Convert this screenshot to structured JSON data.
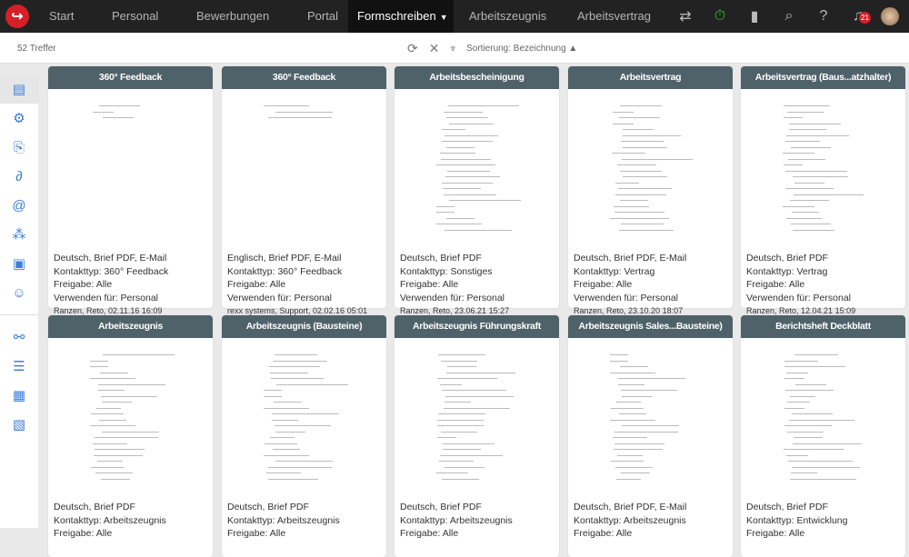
{
  "nav": {
    "tabs": [
      "Start",
      "Personal",
      "Bewerbungen",
      "Portal",
      "Formschreiben",
      "Arbeitszeugnis",
      "Arbeitsvertrag"
    ],
    "active": "Formschreiben",
    "notifications": "21"
  },
  "toolbar": {
    "hits": "52 Treffer",
    "sort": "Sortierung: Bezeichnung ▲"
  },
  "cards": [
    {
      "title": "360° Feedback",
      "lines": [
        "Deutsch, Brief PDF, E-Mail",
        "Kontakttyp: 360° Feedback",
        "Freigabe: Alle",
        "Verwenden für: Personal"
      ],
      "meta": "Ranzen, Reto, 02.11.16 16:09"
    },
    {
      "title": "360° Feedback",
      "lines": [
        "Englisch, Brief PDF, E-Mail",
        "Kontakttyp: 360° Feedback",
        "Freigabe: Alle",
        "Verwenden für: Personal"
      ],
      "meta": "rexx systems, Support, 02.02.16 05:01"
    },
    {
      "title": "Arbeitsbescheinigung",
      "lines": [
        "Deutsch, Brief PDF",
        "Kontakttyp: Sonstiges",
        "Freigabe: Alle",
        "Verwenden für: Personal"
      ],
      "meta": "Ranzen, Reto, 23.06.21 15:27"
    },
    {
      "title": "Arbeitsvertrag",
      "lines": [
        "Deutsch, Brief PDF, E-Mail",
        "Kontakttyp: Vertrag",
        "Freigabe: Alle",
        "Verwenden für: Personal"
      ],
      "meta": "Ranzen, Reto, 23.10.20 18:07"
    },
    {
      "title": "Arbeitsvertrag (Baus...atzhalter)",
      "lines": [
        "Deutsch, Brief PDF",
        "Kontakttyp: Vertrag",
        "Freigabe: Alle",
        "Verwenden für: Personal"
      ],
      "meta": "Ranzen, Reto, 12.04.21 15:09"
    },
    {
      "title": "Arbeitszeugnis",
      "lines": [
        "Deutsch, Brief PDF",
        "Kontakttyp: Arbeitszeugnis",
        "Freigabe: Alle"
      ]
    },
    {
      "title": "Arbeitszeugnis (Bausteine)",
      "lines": [
        "Deutsch, Brief PDF",
        "Kontakttyp: Arbeitszeugnis",
        "Freigabe: Alle"
      ]
    },
    {
      "title": "Arbeitszeugnis Führungskraft",
      "lines": [
        "Deutsch, Brief PDF",
        "Kontakttyp: Arbeitszeugnis",
        "Freigabe: Alle"
      ]
    },
    {
      "title": "Arbeitszeugnis Sales...Bausteine)",
      "lines": [
        "Deutsch, Brief PDF, E-Mail",
        "Kontakttyp: Arbeitszeugnis",
        "Freigabe: Alle"
      ]
    },
    {
      "title": "Berichtsheft Deckblatt",
      "lines": [
        "Deutsch, Brief PDF",
        "Kontakttyp: Entwicklung",
        "Freigabe: Alle"
      ]
    }
  ]
}
